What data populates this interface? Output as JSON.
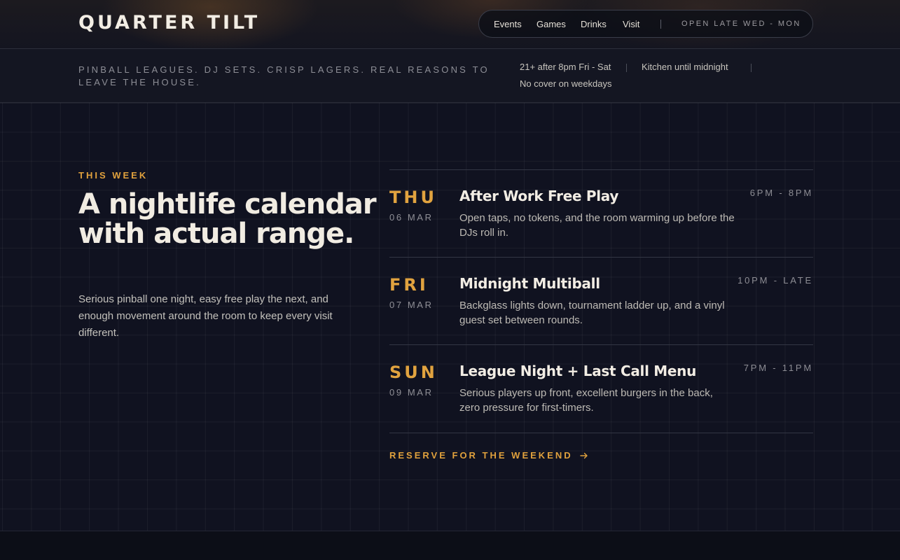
{
  "brand": {
    "name": "QUARTER TILT"
  },
  "nav": {
    "links": [
      "Events",
      "Games",
      "Drinks",
      "Visit"
    ],
    "hours": "OPEN LATE WED - MON"
  },
  "subheader": {
    "tagline": "PINBALL LEAGUES. DJ SETS. CRISP LAGERS. REAL REASONS TO LEAVE THE HOUSE.",
    "info": [
      "21+ after 8pm Fri - Sat",
      "Kitchen until midnight",
      "No cover on weekdays"
    ]
  },
  "intro": {
    "eyebrow": "THIS WEEK",
    "headline": "A nightlife calendar with actual range.",
    "body": "Serious pinball one night, easy free play the next, and enough movement around the room to keep every visit different."
  },
  "events": [
    {
      "dow": "THU",
      "date": "06 MAR",
      "title": "After Work Free Play",
      "description": "Open taps, no tokens, and the room warming up before the DJs roll in.",
      "time": "6PM - 8PM"
    },
    {
      "dow": "FRI",
      "date": "07 MAR",
      "title": "Midnight Multiball",
      "description": "Backglass lights down, tournament ladder up, and a vinyl guest set between rounds.",
      "time": "10PM - LATE"
    },
    {
      "dow": "SUN",
      "date": "09 MAR",
      "title": "League Night + Last Call Menu",
      "description": "Serious players up front, excellent burgers in the back, zero pressure for first-timers.",
      "time": "7PM - 11PM"
    }
  ],
  "cta": {
    "label": "RESERVE FOR THE WEEKEND",
    "icon": "arrow-right-icon"
  },
  "colors": {
    "accent": "#e0a13d",
    "background": "#101220",
    "text": "#f1ece2"
  }
}
